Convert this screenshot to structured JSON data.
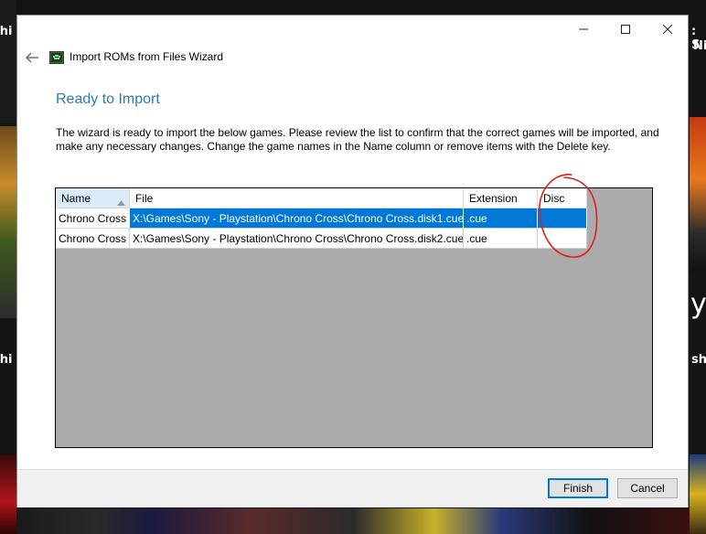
{
  "background": {
    "left_top_text": "shi",
    "right_top_text_1": ": S",
    "right_top_text_2": "Ni",
    "right_mid_text": "sh",
    "left_mid_text": "shi",
    "right_big_text": "y"
  },
  "window": {
    "minimize_glyph": "—",
    "maximize_glyph": "☐",
    "close_glyph": "✕"
  },
  "wizard": {
    "title": "Import ROMs from Files Wizard",
    "heading": "Ready to Import",
    "instructions": "The wizard is ready to import the below games. Please review the list to confirm that the correct games will be imported, and make any necessary changes. Change the game names in the Name column or remove items with the Delete key."
  },
  "grid": {
    "columns": [
      "Name",
      "File",
      "Extension",
      "Disc"
    ],
    "sort_indicator": "▲",
    "rows": [
      {
        "name": "Chrono Cross",
        "file": "X:\\Games\\Sony - Playstation\\Chrono Cross\\Chrono Cross.disk1.cue",
        "extension": ".cue",
        "disc": ""
      },
      {
        "name": "Chrono Cross",
        "file": "X:\\Games\\Sony - Playstation\\Chrono Cross\\Chrono Cross.disk2.cue",
        "extension": ".cue",
        "disc": ""
      }
    ]
  },
  "footer": {
    "finish_label": "Finish",
    "cancel_label": "Cancel"
  },
  "colors": {
    "accent": "#0078d7",
    "heading": "#2a7ab0",
    "annotation": "#e0201a",
    "grid_background": "#ababab"
  }
}
